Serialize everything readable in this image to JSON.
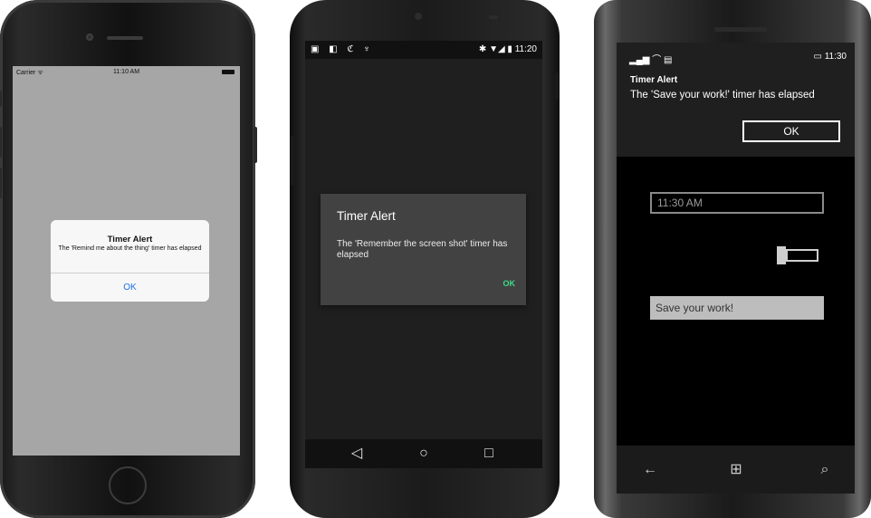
{
  "ios": {
    "status": {
      "carrier": "Carrier ᯤ",
      "time": "11:10 AM"
    },
    "alert": {
      "title": "Timer Alert",
      "message": "The 'Remind me about the thing' timer has elapsed",
      "ok": "OK"
    }
  },
  "android": {
    "status": {
      "left_icons": "▣ ◧ ℭ ♆",
      "right": "✱ ▼◢ ▮ 11:20"
    },
    "dialog": {
      "title": "Timer Alert",
      "message": "The 'Remember the screen shot' timer has elapsed",
      "ok": "OK"
    },
    "nav": {
      "back": "◁",
      "home": "○",
      "recent": "□"
    }
  },
  "winphone": {
    "status": {
      "signal": "▂▄▆ ⌒ ▤",
      "right": "▭ 11:30"
    },
    "notification": {
      "title": "Timer Alert",
      "message": "The 'Save your work!' timer has elapsed",
      "ok": "OK"
    },
    "time_value": "11:30 AM",
    "text_value": "Save your work!",
    "nav": {
      "back": "←",
      "windows": "⊞",
      "search": "⌕"
    }
  },
  "colors": {
    "ios_ok": "#1a73e8",
    "android_ok": "#3ddc84",
    "android_dialog": "#424242",
    "winphone_notification": "#1f1f1f"
  }
}
